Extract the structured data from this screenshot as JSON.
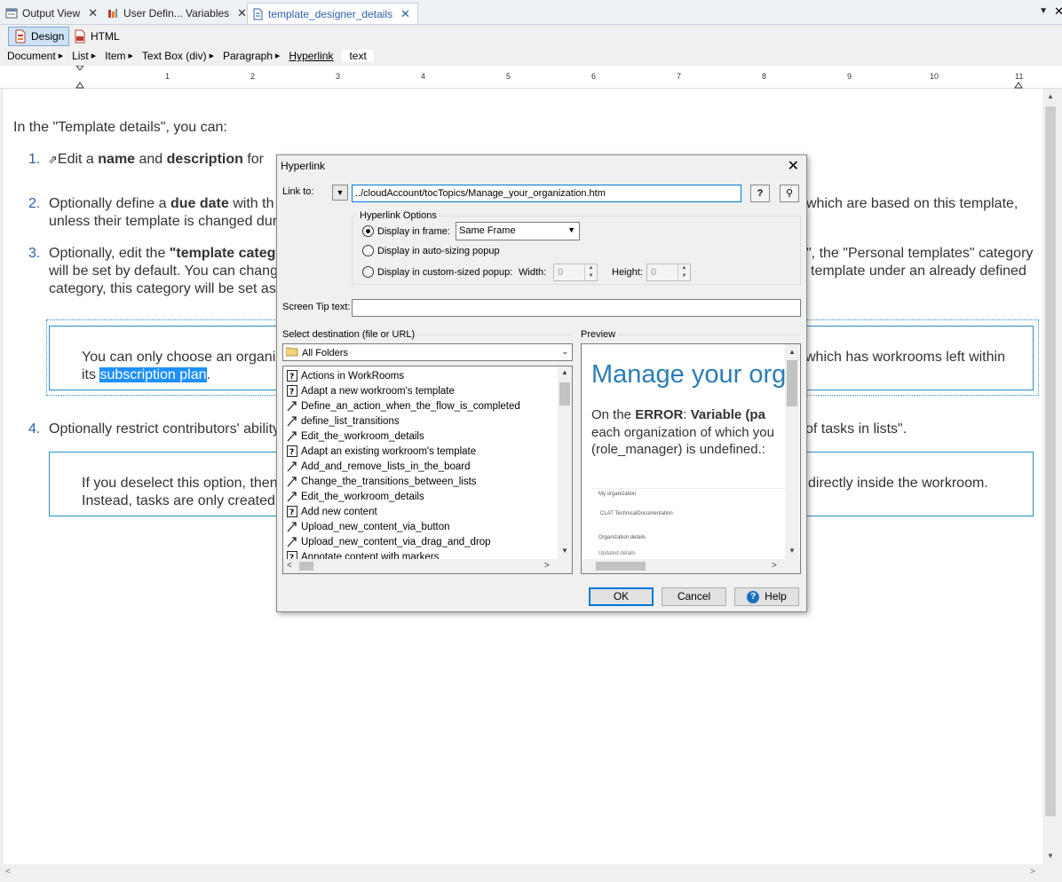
{
  "tabs": [
    {
      "label": "Output View",
      "icon": "output-view-icon"
    },
    {
      "label": "User Defin... Variables",
      "icon": "variables-icon"
    },
    {
      "label": "template_designer_details",
      "icon": "topic-icon"
    }
  ],
  "toolbar": {
    "design_label": "Design",
    "html_label": "HTML"
  },
  "breadcrumbs": [
    "Document",
    "List",
    "Item",
    "Text Box (div)",
    "Paragraph",
    "Hyperlink",
    "text"
  ],
  "ruler": {
    "numbers": [
      "1",
      "2",
      "3",
      "4",
      "5",
      "6",
      "7",
      "8",
      "9",
      "10",
      "11"
    ]
  },
  "editor": {
    "intro": "In the \"Template details\", you can:",
    "item1_num": "1.",
    "item1_a": "Edit a ",
    "item1_b": "name",
    "item1_c": " and ",
    "item1_d": "description",
    "item1_e": " for",
    "item2_num": "2.",
    "item2_a": "Optionally define a ",
    "item2_b": "due date",
    "item2_c": " with th",
    "item2_right": "which are based on this template,",
    "item2_line2": "unless their template is changed duri",
    "item3_num": "3.",
    "item3_a": "Optionally, edit the ",
    "item3_b": "\"template categ",
    "item3_right": "\", the \"Personal templates\" category",
    "item3_line2": "will be set by default. You can chang",
    "item3_line2_right": "template under an already defined",
    "item3_line3": "category, this category will be set as",
    "note1_a": "You can only choose an organiz",
    "note1_right": "which has workrooms left within",
    "note1_b": "its ",
    "note1_sel": "subscription plan",
    "note1_c": ".",
    "item4_num": "4.",
    "item4_a": "Optionally restrict contributors' ability",
    "item4_right": "of tasks in lists\".",
    "note2_a": "If you deselect this option, then",
    "note2_right": "directly inside the workroom.",
    "note2_b": "Instead, tasks are only created"
  },
  "dialog": {
    "title": "Hyperlink",
    "link_to_label": "Link to:",
    "link_to_value": "../cloudAccount/tocTopics/Manage_your_organization.htm",
    "options_title": "Hyperlink Options",
    "radio_frame": "Display in frame:",
    "frame_value": "Same Frame",
    "radio_auto": "Display in auto-sizing popup",
    "radio_custom": "Display in custom-sized popup:",
    "width_label": "Width:",
    "width_value": "0",
    "height_label": "Height:",
    "height_value": "0",
    "screen_tip_label": "Screen Tip text:",
    "screen_tip_value": "",
    "select_dest_label": "Select destination (file or URL)",
    "preview_label": "Preview",
    "folder_value": "All Folders",
    "files": [
      {
        "name": "Actions in WorkRooms",
        "type": "topic"
      },
      {
        "name": "Adapt a new workroom's template",
        "type": "topic"
      },
      {
        "name": "Define_an_action_when_the_flow_is_completed",
        "type": "link"
      },
      {
        "name": "define_list_transitions",
        "type": "link"
      },
      {
        "name": "Edit_the_workroom_details",
        "type": "link"
      },
      {
        "name": "Adapt an existing workroom's template",
        "type": "topic"
      },
      {
        "name": "Add_and_remove_lists_in_the_board",
        "type": "link"
      },
      {
        "name": "Change_the_transitions_between_lists",
        "type": "link"
      },
      {
        "name": "Edit_the_workroom_details",
        "type": "link"
      },
      {
        "name": "Add new content",
        "type": "topic"
      },
      {
        "name": "Upload_new_content_via_button",
        "type": "link"
      },
      {
        "name": "Upload_new_content_via_drag_and_drop",
        "type": "link"
      },
      {
        "name": "Annotate content with markers",
        "type": "topic"
      }
    ],
    "preview": {
      "heading": "Manage your org",
      "p1_a": "On the ",
      "p1_b": "ERROR",
      "p1_c": ": ",
      "p1_d": "Variable (pa",
      "p2": "each organization of which you",
      "p3": "(role_manager) is undefined.:",
      "thumb_title": "My organization",
      "thumb_line": "CLAT TechnicalDocumentation",
      "thumb_sub": "Organization details",
      "thumb_foot": "Updated details"
    },
    "ok_label": "OK",
    "cancel_label": "Cancel",
    "help_label": "Help"
  }
}
